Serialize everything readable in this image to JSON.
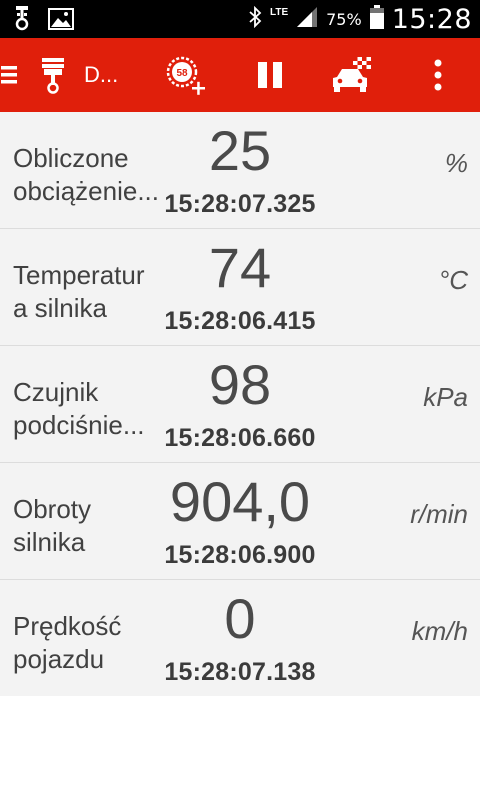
{
  "status_bar": {
    "left_icons": [
      "usb-debug-icon",
      "gallery-icon"
    ],
    "bluetooth_icon": "bluetooth-icon",
    "network_label": "LTE",
    "signal_icon": "signal-icon",
    "battery_percent": "75%",
    "battery_icon": "battery-icon",
    "time": "15:28"
  },
  "toolbar": {
    "background": "#e01f0b",
    "menu_icon": "hamburger-menu-icon",
    "app_icon": "piston-icon",
    "title": "D...",
    "add_gauge_icon": "add-gauge-icon",
    "add_gauge_number": "58",
    "pause_icon": "pause-icon",
    "race_icon": "car-race-flag-icon",
    "overflow_icon": "more-vert-icon"
  },
  "rows": [
    {
      "name_line1": "Obliczone",
      "name_line2": "obciążenie...",
      "value": "25",
      "time": "15:28:07.325",
      "unit": "%"
    },
    {
      "name_line1": "Temperatur",
      "name_line2": "a silnika",
      "value": "74",
      "time": "15:28:06.415",
      "unit": "°C"
    },
    {
      "name_line1": "Czujnik",
      "name_line2": "podciśnie...",
      "value": "98",
      "time": "15:28:06.660",
      "unit": "kPa"
    },
    {
      "name_line1": "Obroty",
      "name_line2": "silnika",
      "value": "904,0",
      "time": "15:28:06.900",
      "unit": "r/min"
    },
    {
      "name_line1": "Prędkość",
      "name_line2": "pojazdu",
      "value": "0",
      "time": "15:28:07.138",
      "unit": "km/h"
    }
  ]
}
